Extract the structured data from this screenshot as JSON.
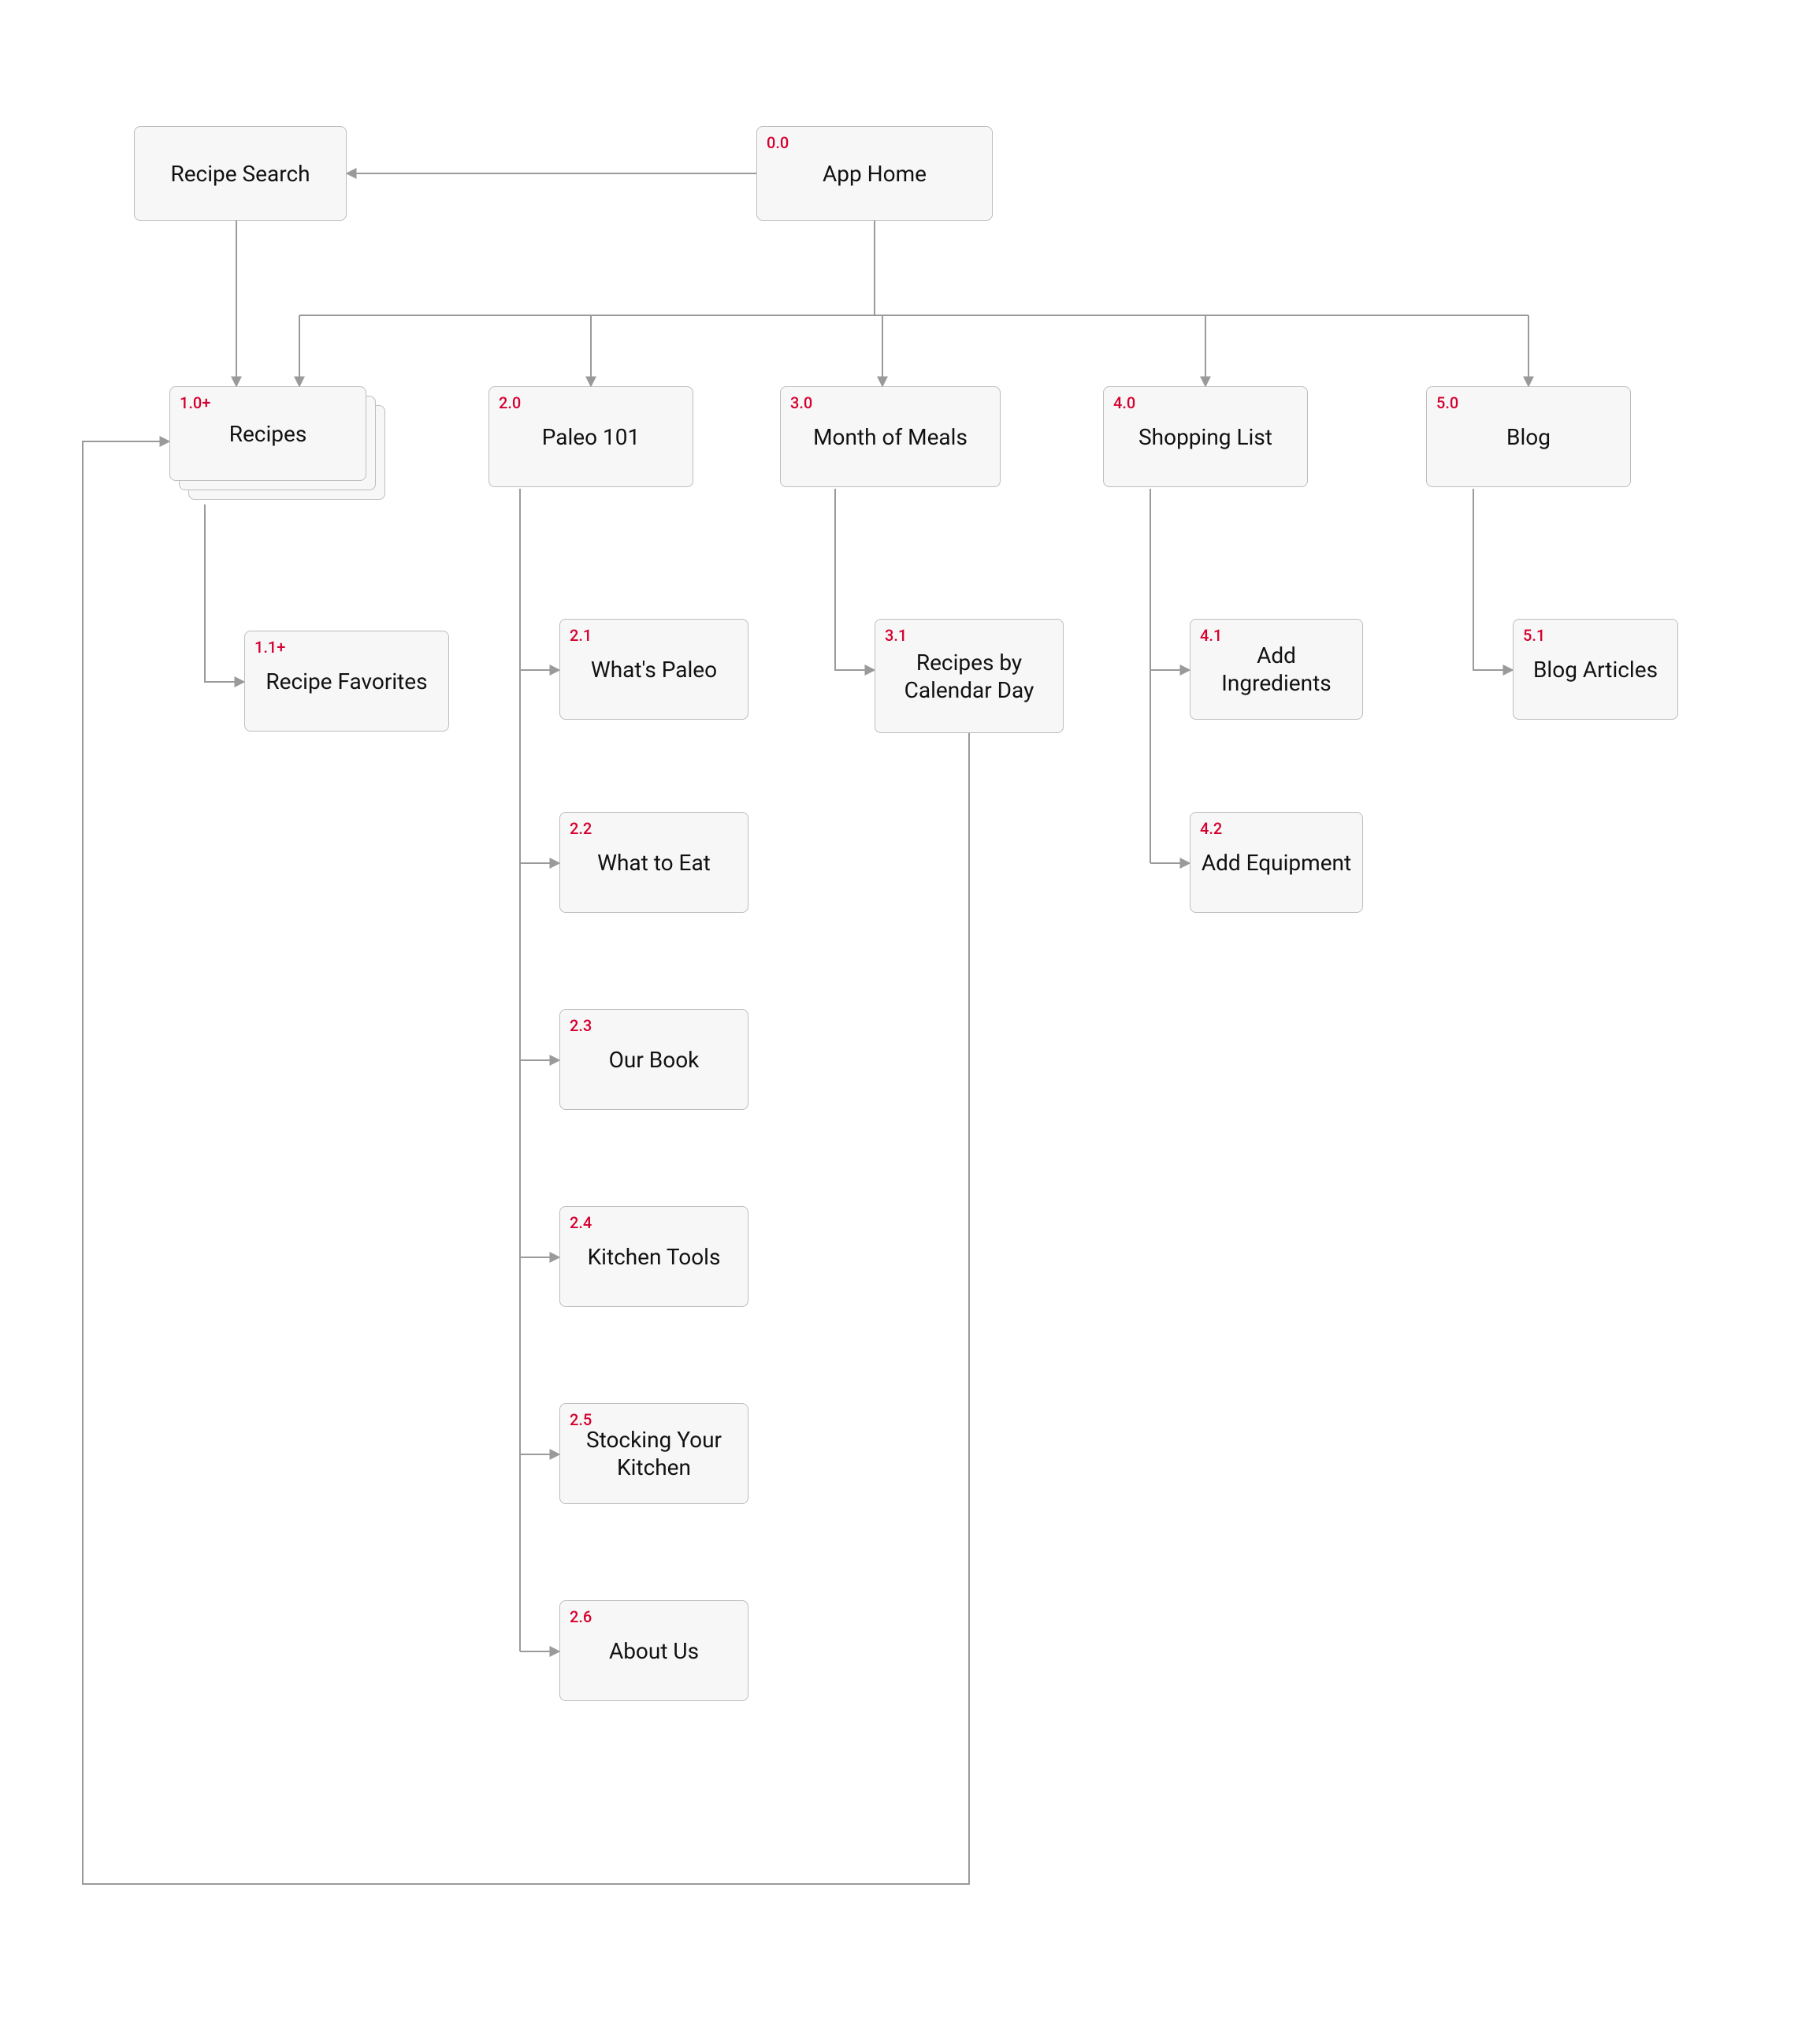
{
  "colors": {
    "ref": "#d5002f",
    "fill": "#f7f7f7",
    "stroke": "#bdbdbd",
    "line": "#9a9a9a"
  },
  "nodes": {
    "recipe_search": {
      "label": "Recipe Search"
    },
    "app_home": {
      "num": "0.0",
      "label": "App Home"
    },
    "recipes": {
      "num": "1.0+",
      "label": "Recipes"
    },
    "paleo_101": {
      "num": "2.0",
      "label": "Paleo 101"
    },
    "month_meals": {
      "num": "3.0",
      "label": "Month of Meals"
    },
    "shopping_list": {
      "num": "4.0",
      "label": "Shopping List"
    },
    "blog": {
      "num": "5.0",
      "label": "Blog"
    },
    "recipe_fav": {
      "num": "1.1+",
      "label": "Recipe Favorites"
    },
    "whats_paleo": {
      "num": "2.1",
      "label": "What's Paleo"
    },
    "what_to_eat": {
      "num": "2.2",
      "label": "What to Eat"
    },
    "our_book": {
      "num": "2.3",
      "label": "Our Book"
    },
    "kitchen_tools": {
      "num": "2.4",
      "label": "Kitchen Tools"
    },
    "stocking": {
      "num": "2.5",
      "label": "Stocking Your Kitchen"
    },
    "about_us": {
      "num": "2.6",
      "label": "About Us"
    },
    "recipes_cal": {
      "num": "3.1",
      "label": "Recipes by Calendar Day"
    },
    "add_ing": {
      "num": "4.1",
      "label": "Add Ingredients"
    },
    "add_equip": {
      "num": "4.2",
      "label": "Add Equipment"
    },
    "blog_articles": {
      "num": "5.1",
      "label": "Blog Articles"
    }
  }
}
